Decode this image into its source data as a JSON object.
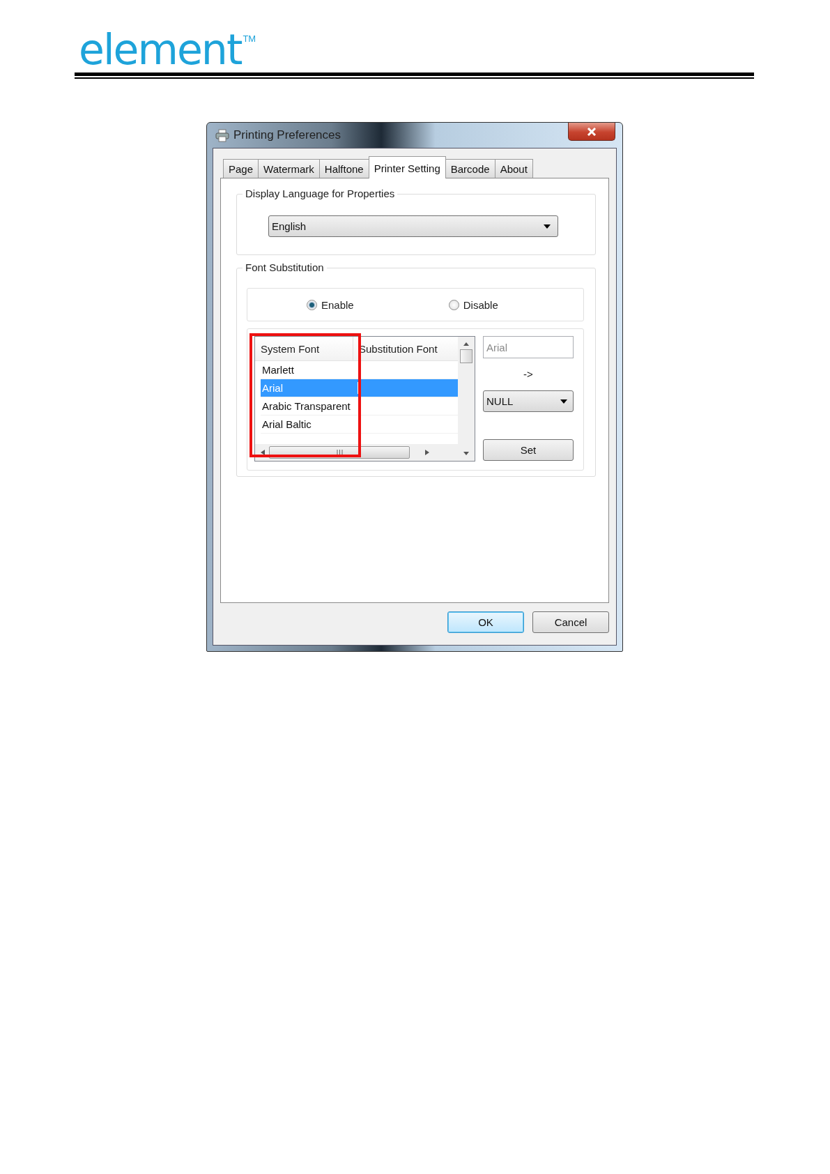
{
  "logo": {
    "text": "element",
    "trademark": "TM"
  },
  "window": {
    "title": "Printing Preferences"
  },
  "tabs": [
    {
      "label": "Page",
      "selected": false
    },
    {
      "label": "Watermark",
      "selected": false
    },
    {
      "label": "Halftone",
      "selected": false
    },
    {
      "label": "Printer Setting",
      "selected": true
    },
    {
      "label": "Barcode",
      "selected": false
    },
    {
      "label": "About",
      "selected": false
    }
  ],
  "display_language": {
    "label": "Display Language for Properties",
    "value": "English"
  },
  "font_substitution": {
    "label": "Font Substitution",
    "options": [
      {
        "label": "Enable",
        "selected": true
      },
      {
        "label": "Disable",
        "selected": false
      }
    ],
    "table": {
      "columns": [
        "System Font",
        "Substitution Font"
      ],
      "rows": [
        {
          "system_font": "Marlett",
          "selected": false
        },
        {
          "system_font": "Arial",
          "selected": true
        },
        {
          "system_font": "Arabic Transparent",
          "selected": false
        },
        {
          "system_font": "Arial Baltic",
          "selected": false
        }
      ]
    },
    "font_field": {
      "value": "Arial",
      "disabled": true
    },
    "arrow": "->",
    "substitute": {
      "value": "NULL"
    },
    "set_button": "Set"
  },
  "buttons": [
    {
      "label": "OK",
      "default": true
    },
    {
      "label": "Cancel",
      "default": false
    }
  ]
}
